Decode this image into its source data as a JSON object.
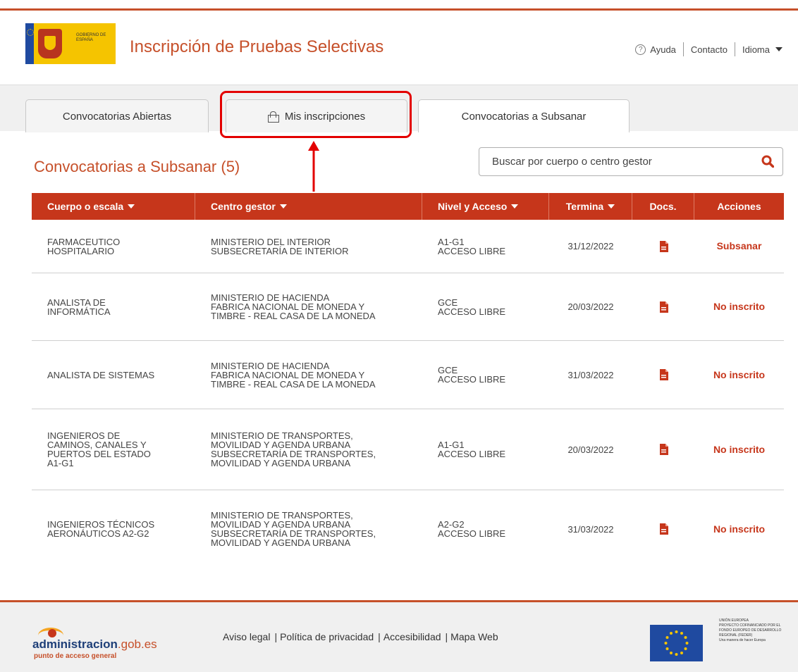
{
  "header": {
    "logo_text": "GOBIERNO DE ESPAÑA",
    "title": "Inscripción de Pruebas Selectivas",
    "help_label": "Ayuda",
    "contact_label": "Contacto",
    "language_label": "Idioma"
  },
  "tabs": [
    {
      "label": "Convocatorias Abiertas"
    },
    {
      "label": "Mis inscripciones"
    },
    {
      "label": "Convocatorias a Subsanar"
    }
  ],
  "section": {
    "title": "Convocatorias a Subsanar (5)"
  },
  "search": {
    "placeholder": "Buscar por cuerpo o centro gestor"
  },
  "table": {
    "headers": [
      "Cuerpo o escala",
      "Centro gestor",
      "Nivel y Acceso",
      "Termina",
      "Docs.",
      "Acciones"
    ],
    "rows": [
      {
        "cuerpo": "FARMACEUTICO\nHOSPITALARIO",
        "centro": "MINISTERIO DEL INTERIOR\nSUBSECRETARÍA DE INTERIOR",
        "nivel": "A1-G1\nACCESO LIBRE",
        "termina": "31/12/2022",
        "accion": "Subsanar"
      },
      {
        "cuerpo": "ANALISTA DE\nINFORMÁTICA",
        "centro": "MINISTERIO DE HACIENDA\nFABRICA NACIONAL DE MONEDA Y\nTIMBRE - REAL CASA DE LA MONEDA",
        "nivel": "GCE\nACCESO LIBRE",
        "termina": "20/03/2022",
        "accion": "No inscrito"
      },
      {
        "cuerpo": "ANALISTA DE SISTEMAS",
        "centro": "MINISTERIO DE HACIENDA\nFABRICA NACIONAL DE MONEDA Y\nTIMBRE - REAL CASA DE LA MONEDA",
        "nivel": "GCE\nACCESO LIBRE",
        "termina": "31/03/2022",
        "accion": "No inscrito"
      },
      {
        "cuerpo": "INGENIEROS DE\nCAMINOS, CANALES Y\nPUERTOS DEL ESTADO\nA1-G1",
        "centro": "MINISTERIO DE TRANSPORTES,\nMOVILIDAD Y AGENDA URBANA\nSUBSECRETARÍA DE TRANSPORTES,\nMOVILIDAD Y AGENDA URBANA",
        "nivel": "A1-G1\nACCESO LIBRE",
        "termina": "20/03/2022",
        "accion": "No inscrito"
      },
      {
        "cuerpo": "INGENIEROS TÉCNICOS\nAERONÁUTICOS A2-G2",
        "centro": "MINISTERIO DE TRANSPORTES,\nMOVILIDAD Y AGENDA URBANA\nSUBSECRETARÍA DE TRANSPORTES,\nMOVILIDAD Y AGENDA URBANA",
        "nivel": "A2-G2\nACCESO LIBRE",
        "termina": "31/03/2022",
        "accion": "No inscrito"
      }
    ]
  },
  "footer": {
    "logo_name": "administracion",
    "logo_domain": ".gob.es",
    "logo_sub": "punto de acceso general",
    "links": [
      "Aviso legal",
      "Política de privacidad",
      "Accesibilidad",
      "Mapa Web"
    ],
    "eu_text": "UNIÓN EUROPEA\nPROYECTO COFINANCIADO POR EL FONDO EUROPEO DE DESARROLLO REGIONAL (FEDER)\nUna manera de hacer Europa"
  },
  "colors": {
    "brand": "#c6502a",
    "table_header": "#c6361b",
    "highlight": "#e30000"
  }
}
